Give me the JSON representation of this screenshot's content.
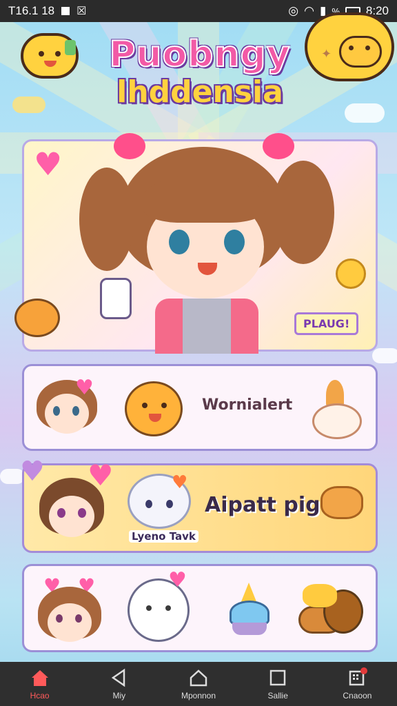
{
  "status_bar": {
    "time_left": "T16.1 18",
    "time_right": "8:20",
    "battery_text": "%"
  },
  "header": {
    "title_line1": "Puobngy",
    "title_line2": "lhddensia"
  },
  "hero": {
    "badge": "PLAUG!"
  },
  "rows": [
    {
      "label": "Wornialert"
    },
    {
      "label": "Aipatt pigl",
      "sublabel": "Lyeno Tavk"
    },
    {
      "label": ""
    }
  ],
  "nav": {
    "items": [
      {
        "label": "Hcao",
        "icon": "home-icon",
        "active": true
      },
      {
        "label": "Miy",
        "icon": "back-triangle-icon",
        "active": false
      },
      {
        "label": "Mponnon",
        "icon": "house-outline-icon",
        "active": false
      },
      {
        "label": "Sallie",
        "icon": "square-icon",
        "active": false
      },
      {
        "label": "Cnaoon",
        "icon": "grid-notification-icon",
        "active": false
      }
    ]
  },
  "colors": {
    "accent_pink": "#f25aa6",
    "accent_yellow": "#ffd23f",
    "nav_active": "#ff5a5a",
    "card_border": "#9b8fd6"
  }
}
